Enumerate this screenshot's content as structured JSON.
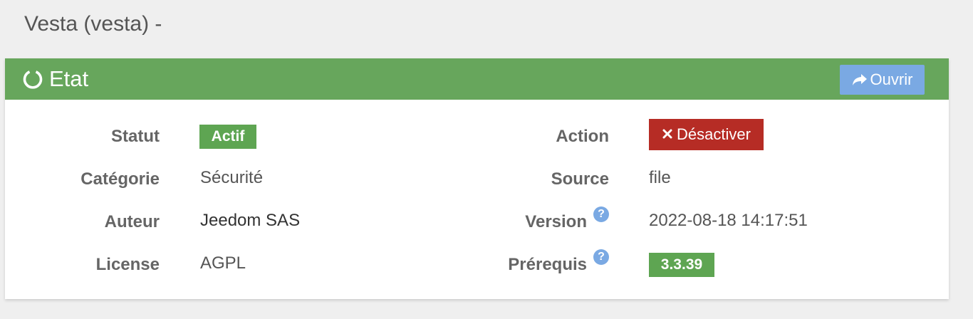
{
  "page": {
    "title": "Vesta (vesta) -"
  },
  "panel": {
    "title": "Etat",
    "open_button_label": "Ouvrir",
    "header_color": "#67a65c"
  },
  "fields": {
    "statut": {
      "label": "Statut",
      "value": "Actif"
    },
    "categorie": {
      "label": "Catégorie",
      "value": "Sécurité"
    },
    "auteur": {
      "label": "Auteur",
      "value": "Jeedom SAS"
    },
    "license": {
      "label": "License",
      "value": "AGPL"
    },
    "action": {
      "label": "Action",
      "button_label": "Désactiver"
    },
    "source": {
      "label": "Source",
      "value": "file"
    },
    "version": {
      "label": "Version",
      "value": "2022-08-18 14:17:51",
      "help": "?"
    },
    "prerequis": {
      "label": "Prérequis",
      "value": "3.3.39",
      "help": "?"
    }
  },
  "icons": {
    "header": "circle-notch-icon",
    "open": "share-arrow-icon",
    "deactivate": "times-icon",
    "help": "question-circle-icon"
  },
  "colors": {
    "success": "#5ea552",
    "danger": "#b62c25",
    "info": "#7aa9e3"
  }
}
